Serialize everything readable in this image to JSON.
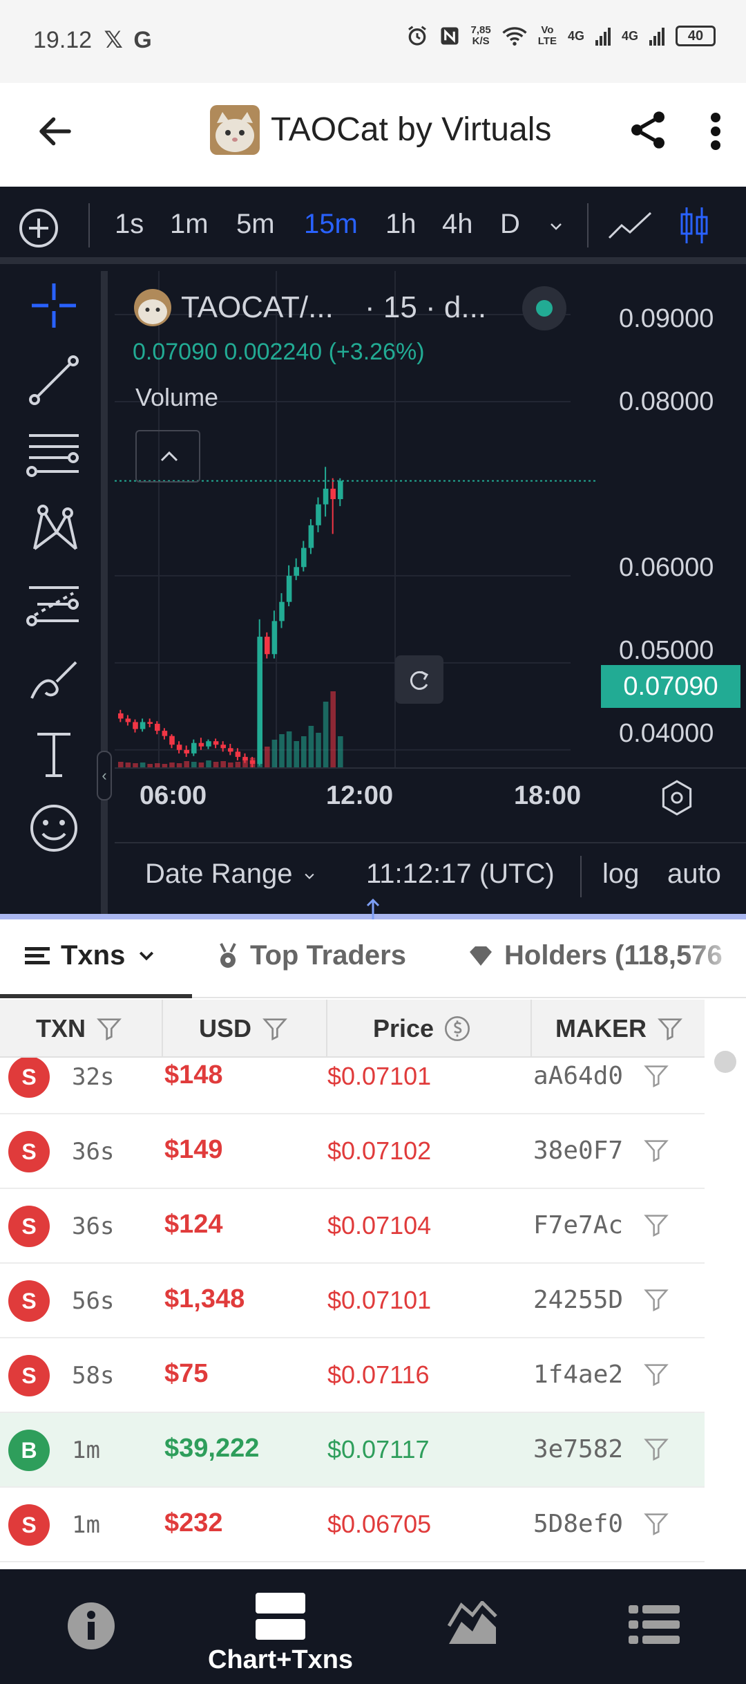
{
  "status_bar": {
    "time": "19.12",
    "notif_x": "𝕏",
    "notif_g": "G",
    "net_speed_value": "7,85",
    "net_speed_unit": "K/S",
    "volte_top": "Vo",
    "volte_bottom": "LTE",
    "sig1": "4G",
    "sig2": "4G",
    "battery": "40"
  },
  "header": {
    "title": "TAOCat by Virtuals"
  },
  "timeframes": [
    "1s",
    "1m",
    "5m",
    "15m",
    "1h",
    "4h",
    "D"
  ],
  "active_timeframe": "15m",
  "legend": {
    "symbol": "TAOCAT/...",
    "interval": "· 15 · d...",
    "values": "0.07090  0.002240 (+3.26%)",
    "volume_label": "Volume"
  },
  "chart_data": {
    "type": "candlestick",
    "title": "",
    "x_ticks": [
      "06:00",
      "12:00",
      "18:00"
    ],
    "y_ticks": [
      "0.09000",
      "0.08000",
      "0.06000",
      "0.05000",
      "0.04000"
    ],
    "ylim": [
      0.038,
      0.095
    ],
    "last_price": "0.07090",
    "up_color": "#22ab94",
    "down_color": "#f23645",
    "candles": [
      [
        0.0442,
        0.0446,
        0.0432,
        0.0436
      ],
      [
        0.0436,
        0.044,
        0.0428,
        0.0432
      ],
      [
        0.0432,
        0.0435,
        0.042,
        0.0424
      ],
      [
        0.0424,
        0.0436,
        0.0421,
        0.0432
      ],
      [
        0.0432,
        0.0436,
        0.0426,
        0.043
      ],
      [
        0.043,
        0.0433,
        0.0418,
        0.0422
      ],
      [
        0.0422,
        0.0425,
        0.0412,
        0.0416
      ],
      [
        0.0416,
        0.0418,
        0.0402,
        0.0406
      ],
      [
        0.0406,
        0.041,
        0.0396,
        0.04
      ],
      [
        0.04,
        0.0405,
        0.0392,
        0.0396
      ],
      [
        0.0396,
        0.0412,
        0.0393,
        0.0408
      ],
      [
        0.0408,
        0.0414,
        0.04,
        0.0404
      ],
      [
        0.0404,
        0.0412,
        0.0401,
        0.041
      ],
      [
        0.041,
        0.0413,
        0.0402,
        0.0406
      ],
      [
        0.0406,
        0.041,
        0.0398,
        0.0402
      ],
      [
        0.0402,
        0.0407,
        0.0394,
        0.0398
      ],
      [
        0.0398,
        0.0402,
        0.0388,
        0.0392
      ],
      [
        0.0392,
        0.0396,
        0.0385,
        0.0388
      ],
      [
        0.0388,
        0.0392,
        0.038,
        0.0384
      ],
      [
        0.0384,
        0.055,
        0.0382,
        0.053
      ],
      [
        0.053,
        0.0535,
        0.0505,
        0.051
      ],
      [
        0.051,
        0.056,
        0.0505,
        0.0548
      ],
      [
        0.0548,
        0.058,
        0.054,
        0.057
      ],
      [
        0.057,
        0.0612,
        0.0565,
        0.06
      ],
      [
        0.06,
        0.062,
        0.0595,
        0.061
      ],
      [
        0.061,
        0.064,
        0.0605,
        0.0632
      ],
      [
        0.0632,
        0.0665,
        0.0625,
        0.0658
      ],
      [
        0.0658,
        0.069,
        0.065,
        0.0682
      ],
      [
        0.0682,
        0.0725,
        0.0668,
        0.07
      ],
      [
        0.07,
        0.0712,
        0.0648,
        0.0688
      ],
      [
        0.0688,
        0.0712,
        0.068,
        0.0709
      ]
    ],
    "volumes": [
      8,
      7,
      6,
      7,
      5,
      6,
      5,
      7,
      6,
      9,
      8,
      7,
      10,
      8,
      9,
      7,
      8,
      12,
      14,
      55,
      30,
      40,
      48,
      52,
      38,
      45,
      60,
      50,
      95,
      110,
      45
    ]
  },
  "bottom_controls": {
    "date_range": "Date Range",
    "utc_time": "11:12:17 (UTC)",
    "log": "log",
    "auto": "auto"
  },
  "tabs": {
    "txns": "Txns",
    "top_traders": "Top Traders",
    "holders": "Holders (118,576"
  },
  "table": {
    "headers": {
      "txn": "TXN",
      "usd": "USD",
      "price": "Price",
      "maker": "MAKER"
    },
    "rows": [
      {
        "type": "S",
        "age": "32s",
        "usd": "$148",
        "price": "$0.07101",
        "maker": "aA64d0"
      },
      {
        "type": "S",
        "age": "36s",
        "usd": "$149",
        "price": "$0.07102",
        "maker": "38e0F7"
      },
      {
        "type": "S",
        "age": "36s",
        "usd": "$124",
        "price": "$0.07104",
        "maker": "F7e7Ac"
      },
      {
        "type": "S",
        "age": "56s",
        "usd": "$1,348",
        "price": "$0.07101",
        "maker": "24255D"
      },
      {
        "type": "S",
        "age": "58s",
        "usd": "$75",
        "price": "$0.07116",
        "maker": "1f4ae2"
      },
      {
        "type": "B",
        "age": "1m",
        "usd": "$39,222",
        "price": "$0.07117",
        "maker": "3e7582"
      },
      {
        "type": "S",
        "age": "1m",
        "usd": "$232",
        "price": "$0.06705",
        "maker": "5D8ef0"
      }
    ]
  },
  "bottom_nav": {
    "chart_txns": "Chart+Txns"
  },
  "colors": {
    "sell": "#e03b3b",
    "buy": "#2e9e5b",
    "accent": "#2962ff"
  }
}
